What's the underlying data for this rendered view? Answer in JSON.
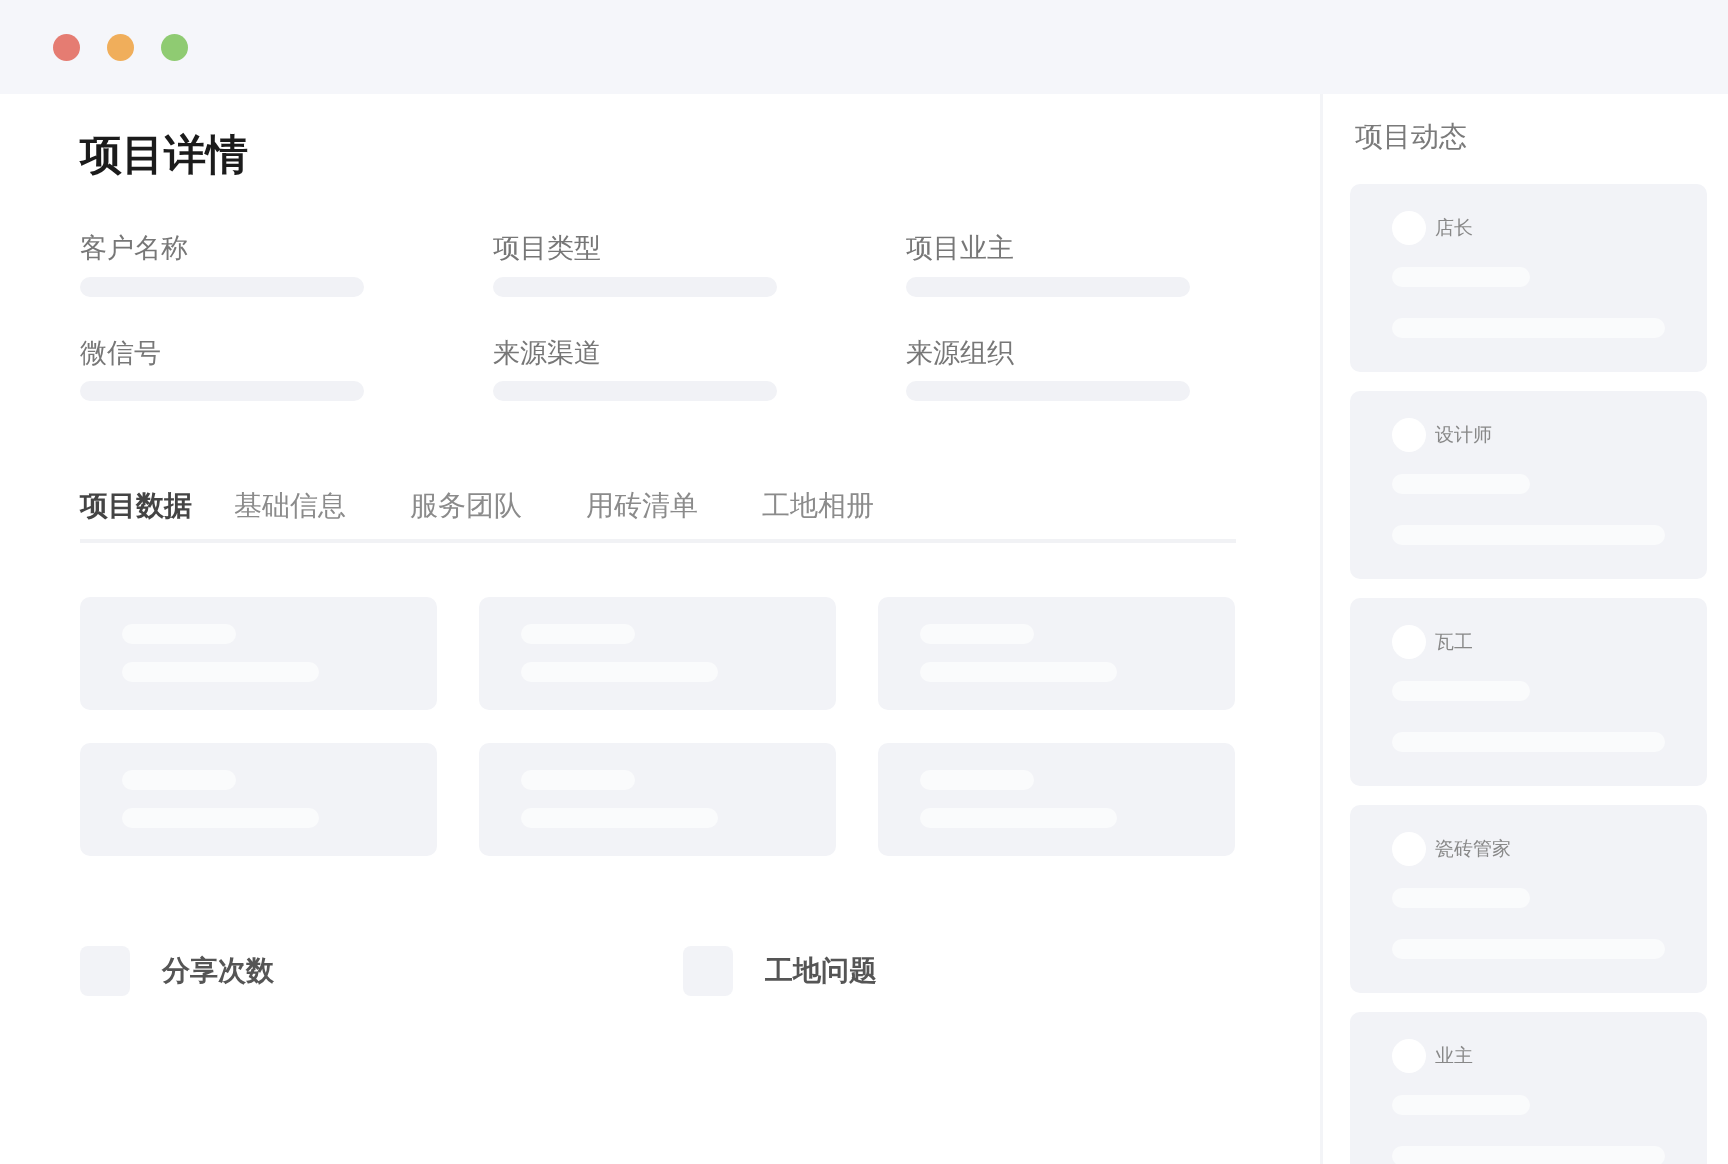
{
  "page": {
    "title": "项目详情"
  },
  "fields": [
    {
      "label": "客户名称"
    },
    {
      "label": "项目类型"
    },
    {
      "label": "项目业主"
    },
    {
      "label": "微信号"
    },
    {
      "label": "来源渠道"
    },
    {
      "label": "来源组织"
    }
  ],
  "tabs": [
    {
      "label": "项目数据",
      "selected": true
    },
    {
      "label": "基础信息",
      "selected": false
    },
    {
      "label": "服务团队",
      "selected": false
    },
    {
      "label": "用砖清单",
      "selected": false
    },
    {
      "label": "工地相册",
      "selected": false
    }
  ],
  "stats": [
    {
      "label": "分享次数"
    },
    {
      "label": "工地问题"
    }
  ],
  "sidebar": {
    "title": "项目动态",
    "items": [
      {
        "role": "店长"
      },
      {
        "role": "设计师"
      },
      {
        "role": "瓦工"
      },
      {
        "role": "瓷砖管家"
      },
      {
        "role": "业主"
      }
    ]
  }
}
